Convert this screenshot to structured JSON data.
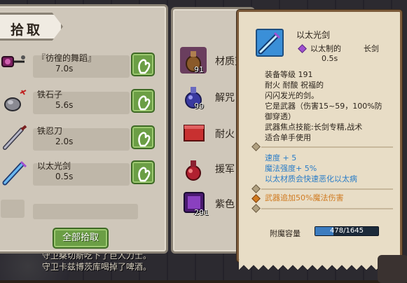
{
  "loot_panel": {
    "tab_label": "拾取",
    "items": [
      {
        "name": "『彷徨的舞蹈』",
        "time": "7.0s",
        "icon": "flail-icon"
      },
      {
        "name": "铁石子",
        "time": "5.6s",
        "icon": "iron-pebble-icon"
      },
      {
        "name": "铁忍刀",
        "time": "2.0s",
        "icon": "ninja-sword-icon"
      },
      {
        "name": "以太光剑",
        "time": "0.5s",
        "icon": "ether-sword-icon"
      }
    ],
    "take_all_label": "全部拾取"
  },
  "inventory": {
    "items": [
      {
        "name": "材质变",
        "count": "91",
        "icon": "potion-bag-icon"
      },
      {
        "name": "解咒",
        "count": "99",
        "icon": "blue-potion-icon"
      },
      {
        "name": "耐火",
        "count": "",
        "icon": "scroll-icon"
      },
      {
        "name": "援军",
        "count": "",
        "icon": "red-potion-icon"
      },
      {
        "name": "紫色",
        "count": "291",
        "icon": "purple-gem-icon"
      }
    ]
  },
  "tooltip": {
    "title": "以太光剑",
    "material": "以太制的",
    "type": "长剑",
    "speed": "0.5s",
    "level_line": "装备等级 191",
    "attributes": "耐火 耐酸 祝福的",
    "flavor": "闪闪发光的剑。",
    "weapon_line1": "它是武器（伤害15~59，100%防",
    "weapon_line2": "御穿透）",
    "focus_line1": "武器焦点技能:长剑专精,战术",
    "focus_line2": "适合单手使用",
    "bonus1": "速度 + 5",
    "bonus2": "魔法强度+ 5%",
    "bonus3": "以太材质会快速恶化以太病",
    "weapon_bonus": "武器追加50%魔法伤害",
    "enchant_label": "附魔容量",
    "enchant_value": "478/1645",
    "enchant_fraction": 0.29
  },
  "chat_log": [
    "守卫桑切斯吃下了巨人力士。",
    "守卫卡兹博茨库喝掉了啤酒。"
  ],
  "colors": {
    "grab_green": "#6b9e45",
    "bonus_blue": "#2a7dc8",
    "weapon_orange": "#d07a20"
  }
}
